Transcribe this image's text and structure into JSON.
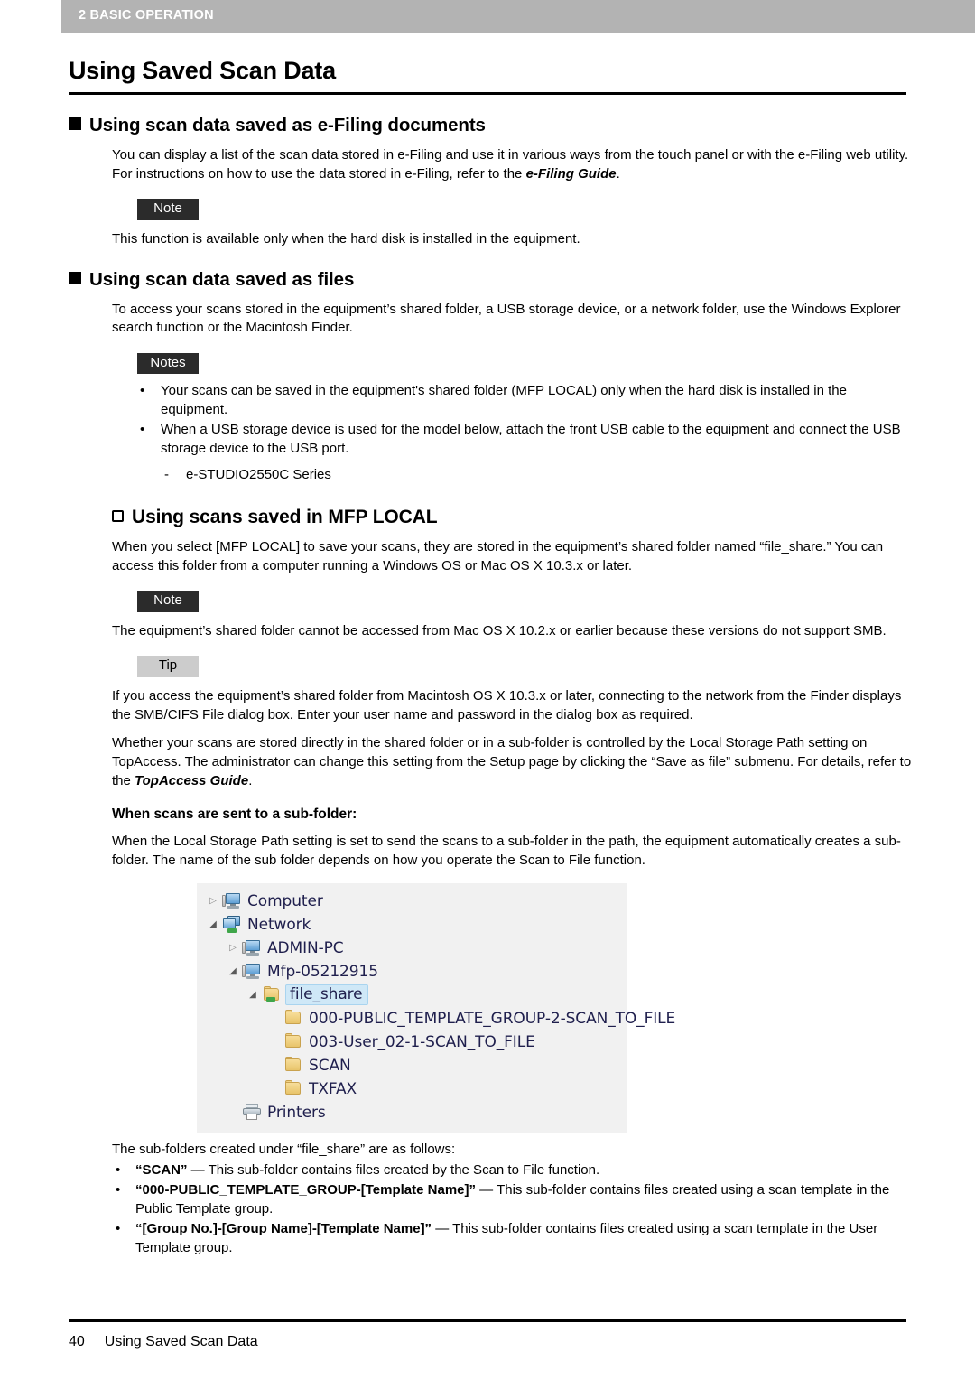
{
  "running_header": {
    "label": "2 BASIC OPERATION"
  },
  "page_title": "Using Saved Scan Data",
  "sections": {
    "efiling": {
      "heading": "Using scan data saved as e-Filing documents",
      "intro_part1": "You can display a list of the scan data stored in e-Filing and use it in various ways from the touch panel or with the e-Filing web utility. For instructions on how to use the data stored in e-Filing, refer to the ",
      "intro_ref": "e-Filing Guide",
      "intro_part2": ".",
      "note_badge": "Note",
      "note_text": "This function is available only when the hard disk is installed in the equipment."
    },
    "files": {
      "heading": "Using scan data saved as files",
      "intro": "To access your scans stored in the equipment’s shared folder, a USB storage device, or a network folder, use the Windows Explorer search function or the Macintosh Finder.",
      "notes_badge": "Notes",
      "notes": [
        "Your scans can be saved in the equipment's shared folder (MFP LOCAL) only when the hard disk is installed in the equipment.",
        "When a USB storage device is used for the model below, attach the front USB cable to the equipment and connect the USB storage device to the USB port."
      ],
      "sub_item": "e-STUDIO2550C Series",
      "sub_item_bullet": "-"
    },
    "mfp_local": {
      "heading": "Using scans saved in MFP LOCAL",
      "intro": "When you select [MFP LOCAL] to save your scans, they are stored in the equipment’s shared folder named “file_share.” You can access this folder from a computer running a Windows OS or Mac OS X 10.3.x or later.",
      "note_badge": "Note",
      "note_text": "The equipment’s shared folder cannot be accessed from Mac OS X 10.2.x or earlier because these versions do not support SMB.",
      "tip_badge": "Tip",
      "tip_text": "If you access the equipment’s shared folder from Macintosh OS X 10.3.x or later, connecting to the network from the Finder displays the SMB/CIFS File dialog box. Enter your user name and password in the dialog box as required.",
      "topaccess_part1": "Whether your scans are stored directly in the shared folder or in a sub-folder is controlled by the Local Storage Path setting on TopAccess. The administrator can change this setting from the Setup page by clicking the “Save as file” submenu. For details, refer to the ",
      "topaccess_ref": "TopAccess Guide",
      "topaccess_part2": ".",
      "subfolder_heading": "When scans are sent to a sub-folder:",
      "subfolder_intro": "When the Local Storage Path setting is set to send the scans to a sub-folder in the path, the equipment automatically creates a sub-folder. The name of the sub folder depends on how you operate the Scan to File function."
    }
  },
  "explorer_tree": {
    "nodes": [
      {
        "label": "Computer",
        "icon": "computer-icon",
        "arrow": "collapsed",
        "indent": 0,
        "selected": false
      },
      {
        "label": "Network",
        "icon": "network-icon",
        "arrow": "expanded",
        "indent": 0,
        "selected": false
      },
      {
        "label": "ADMIN-PC",
        "icon": "computer-icon",
        "arrow": "collapsed",
        "indent": 1,
        "selected": false
      },
      {
        "label": "Mfp-05212915",
        "icon": "computer-icon",
        "arrow": "expanded",
        "indent": 1,
        "selected": false
      },
      {
        "label": "file_share",
        "icon": "shared-folder-icon",
        "arrow": "expanded",
        "indent": 2,
        "selected": true
      },
      {
        "label": "000-PUBLIC_TEMPLATE_GROUP-2-SCAN_TO_FILE",
        "icon": "folder-icon",
        "arrow": "none",
        "indent": 3,
        "selected": false
      },
      {
        "label": "003-User_02-1-SCAN_TO_FILE",
        "icon": "folder-icon",
        "arrow": "none",
        "indent": 3,
        "selected": false
      },
      {
        "label": "SCAN",
        "icon": "folder-icon",
        "arrow": "none",
        "indent": 3,
        "selected": false
      },
      {
        "label": "TXFAX",
        "icon": "folder-icon",
        "arrow": "none",
        "indent": 3,
        "selected": false
      },
      {
        "label": "Printers",
        "icon": "printer-icon",
        "arrow": "none",
        "indent": 1,
        "selected": false
      }
    ],
    "arrow_collapsed_glyph": "▷",
    "arrow_expanded_glyph": "◢"
  },
  "subfolder_list": {
    "intro": "The sub-folders created under “file_share” are as follows:",
    "items": [
      {
        "term": "“SCAN”",
        "desc": " — This sub-folder contains files created by the Scan to File function."
      },
      {
        "term": "“000-PUBLIC_TEMPLATE_GROUP-[Template Name]”",
        "desc": " — This sub-folder contains files created using a scan template in the Public Template group."
      },
      {
        "term": "“[Group No.]-[Group Name]-[Template Name]”",
        "desc": " — This sub-folder contains files created using a scan template in the User Template group."
      }
    ]
  },
  "footer": {
    "page_number": "40",
    "title": "Using Saved Scan Data"
  },
  "colors": {
    "header_bar": "#b3b3b3",
    "badge_dark": "#2b2b2b",
    "badge_light": "#cccccc",
    "tree_background": "#f1f1f1",
    "tree_text": "#1f1f4d",
    "selection": "#cfe8f7"
  }
}
